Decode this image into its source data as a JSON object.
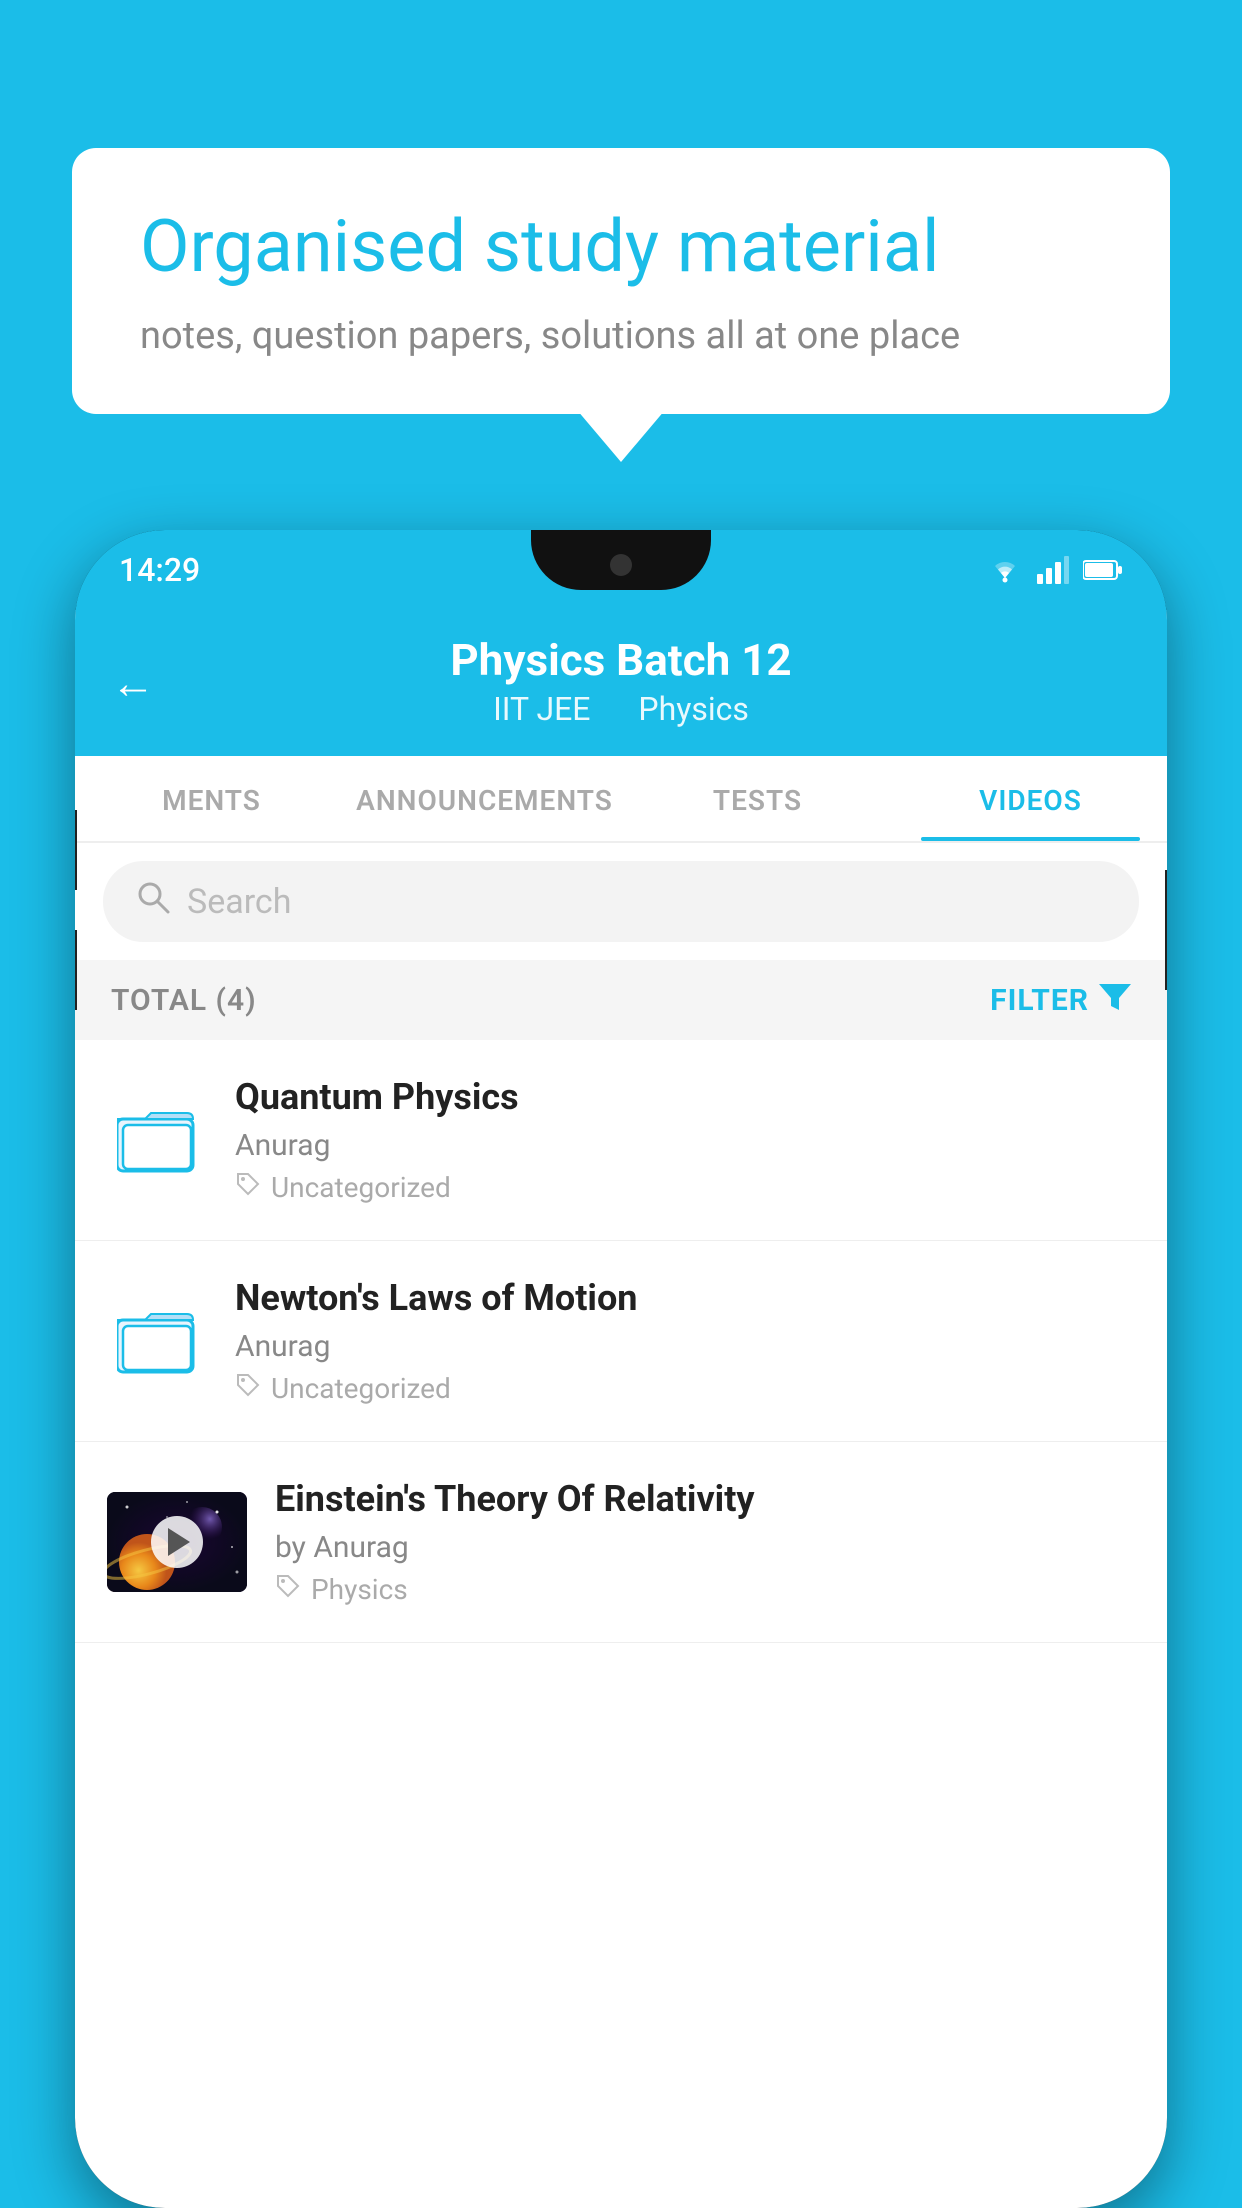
{
  "background_color": "#1BBDE8",
  "speech_bubble": {
    "title": "Organised study material",
    "subtitle": "notes, question papers, solutions all at one place"
  },
  "phone": {
    "status_bar": {
      "time": "14:29",
      "wifi_icon": "▼",
      "signal_icon": "▲",
      "battery_icon": "▮"
    },
    "header": {
      "back_label": "←",
      "title": "Physics Batch 12",
      "subtitle_part1": "IIT JEE",
      "subtitle_part2": "Physics"
    },
    "tabs": [
      {
        "label": "MENTS",
        "active": false
      },
      {
        "label": "ANNOUNCEMENTS",
        "active": false
      },
      {
        "label": "TESTS",
        "active": false
      },
      {
        "label": "VIDEOS",
        "active": true
      }
    ],
    "search": {
      "placeholder": "Search"
    },
    "filter_row": {
      "total_label": "TOTAL (4)",
      "filter_label": "FILTER"
    },
    "videos": [
      {
        "id": 1,
        "title": "Quantum Physics",
        "author": "Anurag",
        "tag": "Uncategorized",
        "type": "folder",
        "has_thumbnail": false
      },
      {
        "id": 2,
        "title": "Newton's Laws of Motion",
        "author": "Anurag",
        "tag": "Uncategorized",
        "type": "folder",
        "has_thumbnail": false
      },
      {
        "id": 3,
        "title": "Einstein's Theory Of Relativity",
        "author": "by Anurag",
        "tag": "Physics",
        "type": "video",
        "has_thumbnail": true
      }
    ]
  }
}
